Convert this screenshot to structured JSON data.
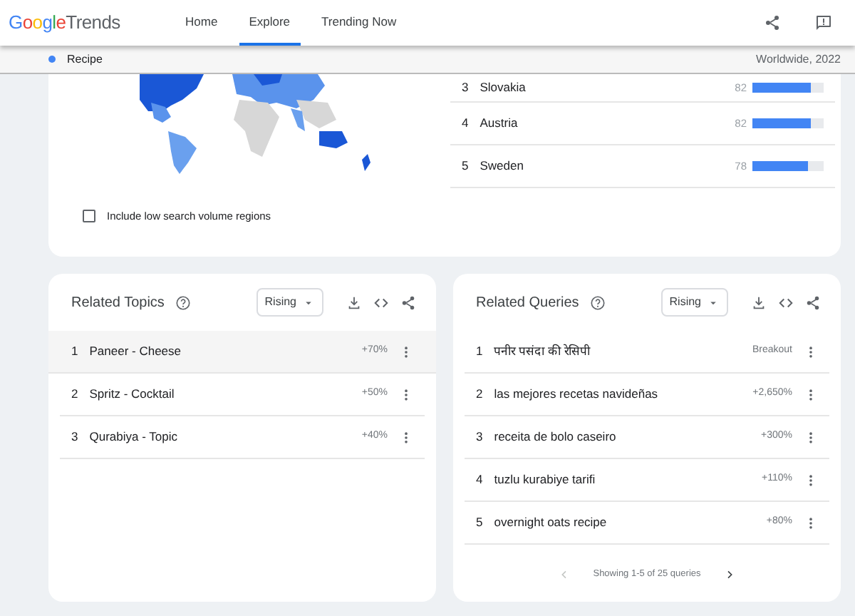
{
  "header": {
    "logo": {
      "brand": "Google",
      "product": "Trends"
    },
    "nav": [
      {
        "label": "Home",
        "selected": false
      },
      {
        "label": "Explore",
        "selected": true
      },
      {
        "label": "Trending Now",
        "selected": false
      }
    ]
  },
  "search_bar": {
    "term": "Recipe",
    "scope": "Worldwide, 2022"
  },
  "interest_by_region": {
    "regions": [
      {
        "rank": "3",
        "name": "Slovakia",
        "value": "82",
        "level": 0.82
      },
      {
        "rank": "4",
        "name": "Austria",
        "value": "82",
        "level": 0.82
      },
      {
        "rank": "5",
        "name": "Sweden",
        "value": "78",
        "level": 0.78
      }
    ],
    "low_volume_checkbox": {
      "label": "Include low search volume regions",
      "checked": false
    }
  },
  "panels": [
    {
      "title": "Related Topics",
      "filter": "Rising",
      "rows": [
        {
          "rank": "1",
          "name": "Paneer - Cheese",
          "value": "+70%",
          "hovered": true
        },
        {
          "rank": "2",
          "name": "Spritz - Cocktail",
          "value": "+50%",
          "hovered": false
        },
        {
          "rank": "3",
          "name": "Qurabiya - Topic",
          "value": "+40%",
          "hovered": false
        }
      ]
    },
    {
      "title": "Related Queries",
      "filter": "Rising",
      "rows": [
        {
          "rank": "1",
          "name": "पनीर पसंदा की रेसिपी",
          "value": "Breakout",
          "hovered": false
        },
        {
          "rank": "2",
          "name": "las mejores recetas navideñas",
          "value": "+2,650%",
          "hovered": false
        },
        {
          "rank": "3",
          "name": "receita de bolo caseiro",
          "value": "+300%",
          "hovered": false
        },
        {
          "rank": "4",
          "name": "tuzlu kurabiye tarifi",
          "value": "+110%",
          "hovered": false
        },
        {
          "rank": "5",
          "name": "overnight oats recipe",
          "value": "+80%",
          "hovered": false
        }
      ],
      "pagination": {
        "text": "Showing 1-5 of 25 queries",
        "prev_disabled": true,
        "next_disabled": false
      }
    }
  ]
}
